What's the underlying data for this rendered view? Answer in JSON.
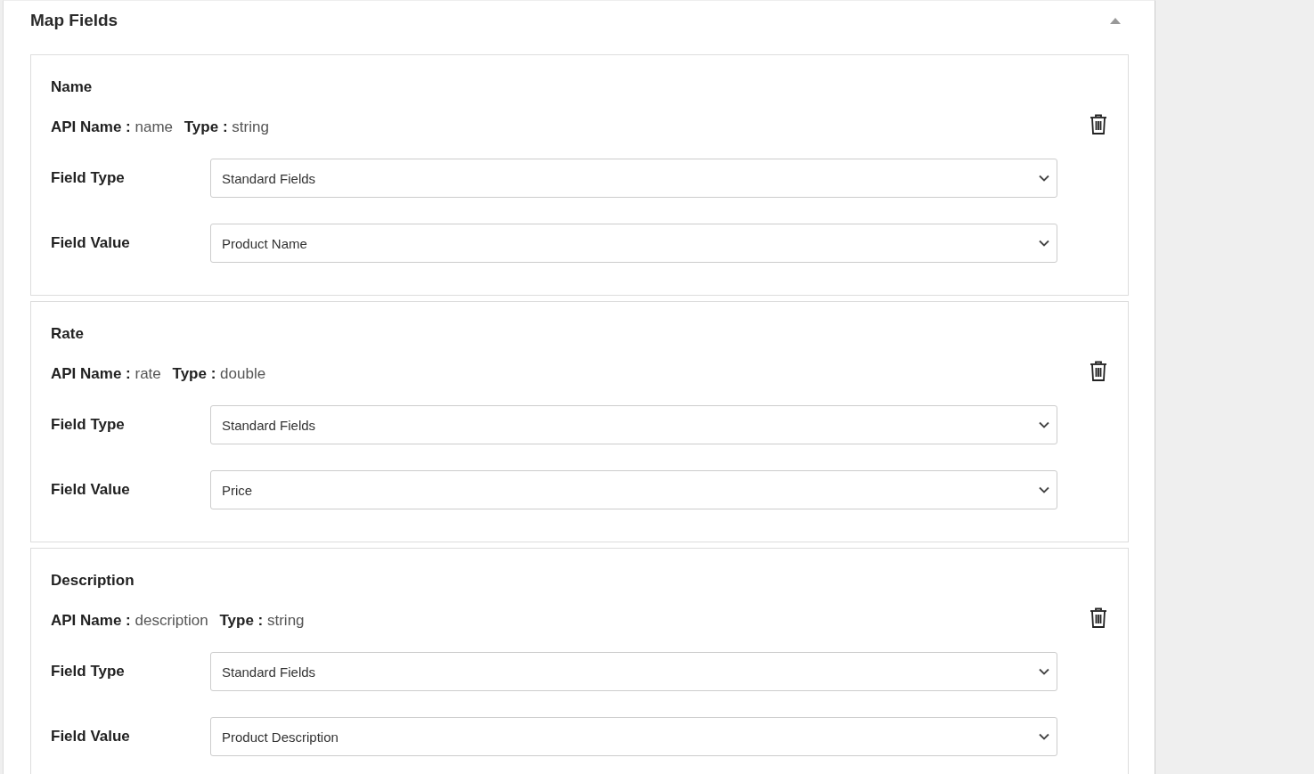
{
  "section": {
    "title": "Map Fields",
    "expanded": true
  },
  "fields": [
    {
      "title": "Name",
      "api_label": "API Name :",
      "api_name": "name",
      "type_label": "Type :",
      "type": "string",
      "rows": [
        {
          "label": "Field Type",
          "value": "Standard Fields"
        },
        {
          "label": "Field Value",
          "value": "Product Name"
        }
      ]
    },
    {
      "title": "Rate",
      "api_label": "API Name :",
      "api_name": "rate",
      "type_label": "Type :",
      "type": "double",
      "rows": [
        {
          "label": "Field Type",
          "value": "Standard Fields"
        },
        {
          "label": "Field Value",
          "value": "Price"
        }
      ]
    },
    {
      "title": "Description",
      "api_label": "API Name :",
      "api_name": "description",
      "type_label": "Type :",
      "type": "string",
      "rows": [
        {
          "label": "Field Type",
          "value": "Standard Fields"
        },
        {
          "label": "Field Value",
          "value": "Product Description"
        }
      ]
    }
  ]
}
